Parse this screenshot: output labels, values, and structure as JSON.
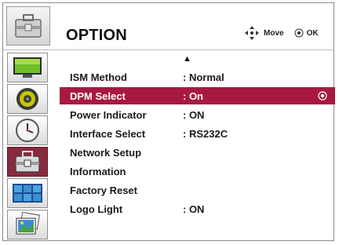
{
  "header": {
    "title": "OPTION",
    "icon": "toolbox-icon",
    "hints": {
      "move_label": "Move",
      "ok_label": "OK",
      "move_icon": "four-way-arrow-icon",
      "ok_icon": "enter-button-icon"
    }
  },
  "sidebar": {
    "items": [
      {
        "name": "picture",
        "icon": "monitor-icon"
      },
      {
        "name": "audio",
        "icon": "speaker-icon"
      },
      {
        "name": "time",
        "icon": "clock-icon"
      },
      {
        "name": "option",
        "icon": "toolbox-icon",
        "active": true
      },
      {
        "name": "tile",
        "icon": "tile-screens-icon"
      },
      {
        "name": "picture-id",
        "icon": "photo-icon"
      }
    ]
  },
  "menu": {
    "scroll_up": "▲",
    "rows": [
      {
        "label": "ISM Method",
        "value": ": Normal"
      },
      {
        "label": "DPM Select",
        "value": ": On",
        "selected": true
      },
      {
        "label": "Power Indicator",
        "value": ": ON"
      },
      {
        "label": "Interface Select",
        "value": ": RS232C"
      },
      {
        "label": "Network Setup",
        "value": ""
      },
      {
        "label": "Information",
        "value": ""
      },
      {
        "label": "Factory Reset",
        "value": ""
      },
      {
        "label": "Logo Light",
        "value": ": ON"
      }
    ]
  },
  "colors": {
    "selection": "#a8193f",
    "active_tab": "#8a2a3f"
  }
}
